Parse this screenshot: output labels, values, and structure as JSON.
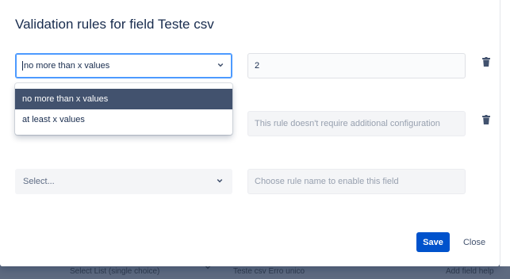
{
  "modal": {
    "title": "Validation rules for field Teste csv",
    "save_label": "Save",
    "close_label": "Close"
  },
  "rules": [
    {
      "rule_select_value": "no more than x values",
      "config_value": "2"
    },
    {
      "config_placeholder": "This rule doesn't require additional configuration"
    },
    {
      "rule_select_placeholder": "Select...",
      "config_placeholder": "Choose rule name to enable this field"
    }
  ],
  "dropdown": {
    "options": [
      "no more than x values",
      "at least x values"
    ],
    "selected_index": 0
  },
  "background": {
    "left_text": "Select List (single choice)",
    "middle_text": "Teste csv Erro unico",
    "right_text": "Add field help"
  },
  "icons": {
    "caret": "chevron-down-icon",
    "trash": "trash-icon"
  },
  "colors": {
    "primary": "#0052cc",
    "selected_option_bg": "#42526e",
    "focus_border": "#4c9aff"
  }
}
